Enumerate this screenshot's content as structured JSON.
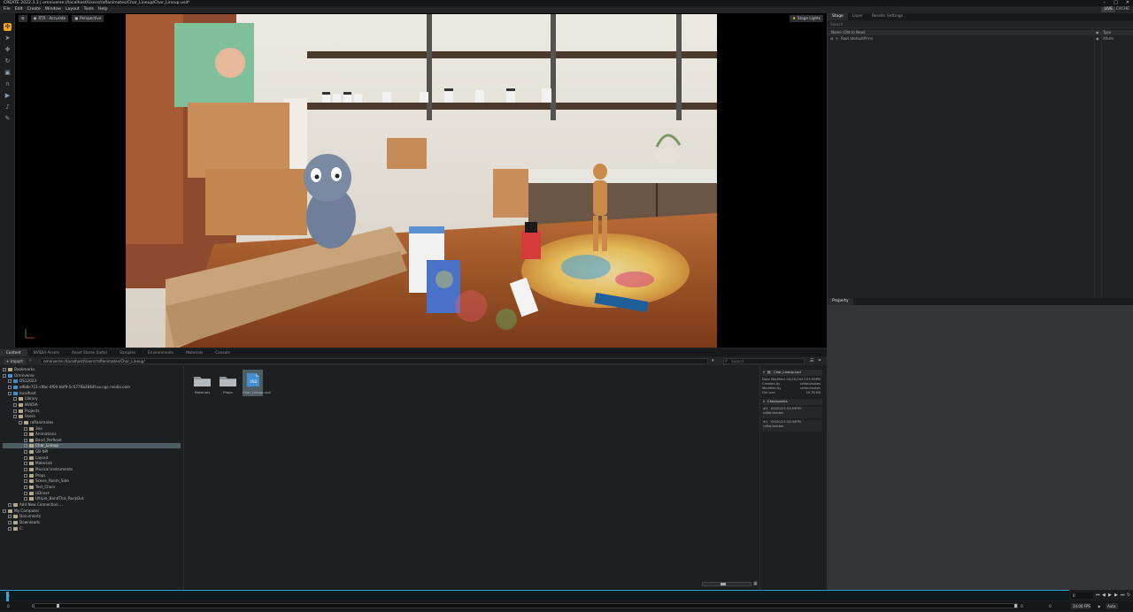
{
  "app": {
    "title": "CREATE  2022.3.3  |  omniverse://localhost/Users/raflanimates/Char_Lineup/Char_Lineup.usd*"
  },
  "menu": {
    "items": [
      "File",
      "Edit",
      "Create",
      "Window",
      "Layout",
      "Tools",
      "Help"
    ],
    "live_badge": "LIVE",
    "cache_label": "CACHE"
  },
  "viewport": {
    "renderer_label": "RTX - Accurate",
    "camera_label": "Perspective",
    "stage_lights_label": "Stage Lights"
  },
  "stage_panel": {
    "tabs": [
      "Stage",
      "Layer",
      "Render Settings"
    ],
    "search_placeholder": "Search",
    "col_name": "Name (Old to New)",
    "col_type": "Type",
    "root_name": "Root (defaultPrim)",
    "root_type": "Xform"
  },
  "property_panel": {
    "tab": "Property"
  },
  "content": {
    "tabs": [
      "Content",
      "NVIDIA Assets",
      "Asset Stores (beta)",
      "Samples",
      "Environments",
      "Materials",
      "Console"
    ],
    "import_label": "+ Import",
    "path": "omniverse://localhost/Users/raflanimates/Char_Lineup/",
    "search_placeholder": "Search",
    "tree": [
      {
        "label": "Bookmarks",
        "depth": 1,
        "icon": "folder"
      },
      {
        "label": "Omniverse",
        "depth": 1,
        "icon": "omni"
      },
      {
        "label": "DS12023",
        "depth": 2,
        "icon": "server"
      },
      {
        "label": "a9b8c721-c0bc-4f00-bbf9-5c5776b2864f.ov.ngc.nvidia.com",
        "depth": 2,
        "icon": "server"
      },
      {
        "label": "localhost",
        "depth": 2,
        "icon": "server"
      },
      {
        "label": "Library",
        "depth": 3,
        "icon": "folder"
      },
      {
        "label": "NVIDIA",
        "depth": 3,
        "icon": "folder"
      },
      {
        "label": "Projects",
        "depth": 3,
        "icon": "folder"
      },
      {
        "label": "Users",
        "depth": 3,
        "icon": "folder"
      },
      {
        "label": "raflanimates",
        "depth": 4,
        "icon": "folder"
      },
      {
        "label": "3ee",
        "depth": 5,
        "icon": "folder"
      },
      {
        "label": "Animations",
        "depth": 5,
        "icon": "folder"
      },
      {
        "label": "Band_Perfkset",
        "depth": 5,
        "icon": "folder"
      },
      {
        "label": "Char_Lineup",
        "depth": 5,
        "icon": "folder",
        "selected": true
      },
      {
        "label": "GB NPI",
        "depth": 5,
        "icon": "folder"
      },
      {
        "label": "Layout",
        "depth": 5,
        "icon": "folder"
      },
      {
        "label": "Materials",
        "depth": 5,
        "icon": "folder"
      },
      {
        "label": "Musical Instruments",
        "depth": 5,
        "icon": "folder"
      },
      {
        "label": "Props",
        "depth": 5,
        "icon": "folder"
      },
      {
        "label": "Scene_Room_Side",
        "depth": 5,
        "icon": "folder"
      },
      {
        "label": "Test_Chars",
        "depth": 5,
        "icon": "folder"
      },
      {
        "label": "UDirect",
        "depth": 5,
        "icon": "folder"
      },
      {
        "label": "Ultiple_BandThis_RockOut",
        "depth": 5,
        "icon": "folder"
      },
      {
        "label": "Add New Connection ...",
        "depth": 2,
        "icon": "add"
      },
      {
        "label": "My Computer",
        "depth": 1,
        "icon": "computer"
      },
      {
        "label": "Documents",
        "depth": 2,
        "icon": "folder"
      },
      {
        "label": "Downloads",
        "depth": 2,
        "icon": "folder"
      },
      {
        "label": "C:",
        "depth": 2,
        "icon": "drive"
      }
    ],
    "items": [
      {
        "label": "Materials",
        "kind": "folder"
      },
      {
        "label": "Props",
        "kind": "folder"
      },
      {
        "label": "Char_Lineup.usd",
        "kind": "usd",
        "selected": true
      }
    ],
    "details": {
      "file_name": "Char_Lineup.usd",
      "date_modified_label": "Date Modified",
      "date_modified": "05/20/2023 03:59PM",
      "created_by_label": "Created by",
      "created_by": "raflanimates",
      "modified_by_label": "Modified by",
      "modified_by": "raflanimates",
      "file_size_label": "File size",
      "file_size": "16.76 KB",
      "checkpoints_label": "Checkpoints",
      "checkpoints": [
        {
          "id": "#2",
          "date": "05/20/23 03:59PM",
          "user": "raflanimates"
        },
        {
          "id": "#1",
          "date": "05/20/23 03:49PM",
          "user": "raflanimates"
        }
      ]
    }
  },
  "timeline": {
    "start_frame": "0",
    "current_frame": "0",
    "range_start": "0",
    "range_start_inner": "0",
    "range_end_inner": "0",
    "range_end": "0",
    "fps": "24.00 FPS",
    "auto_label": "Auto"
  },
  "colors": {
    "accent": "#f0a51a",
    "selection": "#4e5c64",
    "timeline_blue": "#2aa6de"
  }
}
